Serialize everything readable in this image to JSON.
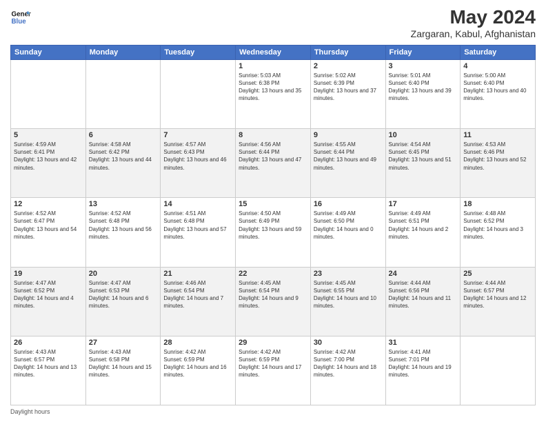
{
  "header": {
    "logo_line1": "General",
    "logo_line2": "Blue",
    "title": "May 2024",
    "subtitle": "Zargaran, Kabul, Afghanistan"
  },
  "days_of_week": [
    "Sunday",
    "Monday",
    "Tuesday",
    "Wednesday",
    "Thursday",
    "Friday",
    "Saturday"
  ],
  "weeks": [
    [
      {
        "day": "",
        "sunrise": "",
        "sunset": "",
        "daylight": ""
      },
      {
        "day": "",
        "sunrise": "",
        "sunset": "",
        "daylight": ""
      },
      {
        "day": "",
        "sunrise": "",
        "sunset": "",
        "daylight": ""
      },
      {
        "day": "1",
        "sunrise": "Sunrise: 5:03 AM",
        "sunset": "Sunset: 6:38 PM",
        "daylight": "Daylight: 13 hours and 35 minutes."
      },
      {
        "day": "2",
        "sunrise": "Sunrise: 5:02 AM",
        "sunset": "Sunset: 6:39 PM",
        "daylight": "Daylight: 13 hours and 37 minutes."
      },
      {
        "day": "3",
        "sunrise": "Sunrise: 5:01 AM",
        "sunset": "Sunset: 6:40 PM",
        "daylight": "Daylight: 13 hours and 39 minutes."
      },
      {
        "day": "4",
        "sunrise": "Sunrise: 5:00 AM",
        "sunset": "Sunset: 6:40 PM",
        "daylight": "Daylight: 13 hours and 40 minutes."
      }
    ],
    [
      {
        "day": "5",
        "sunrise": "Sunrise: 4:59 AM",
        "sunset": "Sunset: 6:41 PM",
        "daylight": "Daylight: 13 hours and 42 minutes."
      },
      {
        "day": "6",
        "sunrise": "Sunrise: 4:58 AM",
        "sunset": "Sunset: 6:42 PM",
        "daylight": "Daylight: 13 hours and 44 minutes."
      },
      {
        "day": "7",
        "sunrise": "Sunrise: 4:57 AM",
        "sunset": "Sunset: 6:43 PM",
        "daylight": "Daylight: 13 hours and 46 minutes."
      },
      {
        "day": "8",
        "sunrise": "Sunrise: 4:56 AM",
        "sunset": "Sunset: 6:44 PM",
        "daylight": "Daylight: 13 hours and 47 minutes."
      },
      {
        "day": "9",
        "sunrise": "Sunrise: 4:55 AM",
        "sunset": "Sunset: 6:44 PM",
        "daylight": "Daylight: 13 hours and 49 minutes."
      },
      {
        "day": "10",
        "sunrise": "Sunrise: 4:54 AM",
        "sunset": "Sunset: 6:45 PM",
        "daylight": "Daylight: 13 hours and 51 minutes."
      },
      {
        "day": "11",
        "sunrise": "Sunrise: 4:53 AM",
        "sunset": "Sunset: 6:46 PM",
        "daylight": "Daylight: 13 hours and 52 minutes."
      }
    ],
    [
      {
        "day": "12",
        "sunrise": "Sunrise: 4:52 AM",
        "sunset": "Sunset: 6:47 PM",
        "daylight": "Daylight: 13 hours and 54 minutes."
      },
      {
        "day": "13",
        "sunrise": "Sunrise: 4:52 AM",
        "sunset": "Sunset: 6:48 PM",
        "daylight": "Daylight: 13 hours and 56 minutes."
      },
      {
        "day": "14",
        "sunrise": "Sunrise: 4:51 AM",
        "sunset": "Sunset: 6:48 PM",
        "daylight": "Daylight: 13 hours and 57 minutes."
      },
      {
        "day": "15",
        "sunrise": "Sunrise: 4:50 AM",
        "sunset": "Sunset: 6:49 PM",
        "daylight": "Daylight: 13 hours and 59 minutes."
      },
      {
        "day": "16",
        "sunrise": "Sunrise: 4:49 AM",
        "sunset": "Sunset: 6:50 PM",
        "daylight": "Daylight: 14 hours and 0 minutes."
      },
      {
        "day": "17",
        "sunrise": "Sunrise: 4:49 AM",
        "sunset": "Sunset: 6:51 PM",
        "daylight": "Daylight: 14 hours and 2 minutes."
      },
      {
        "day": "18",
        "sunrise": "Sunrise: 4:48 AM",
        "sunset": "Sunset: 6:52 PM",
        "daylight": "Daylight: 14 hours and 3 minutes."
      }
    ],
    [
      {
        "day": "19",
        "sunrise": "Sunrise: 4:47 AM",
        "sunset": "Sunset: 6:52 PM",
        "daylight": "Daylight: 14 hours and 4 minutes."
      },
      {
        "day": "20",
        "sunrise": "Sunrise: 4:47 AM",
        "sunset": "Sunset: 6:53 PM",
        "daylight": "Daylight: 14 hours and 6 minutes."
      },
      {
        "day": "21",
        "sunrise": "Sunrise: 4:46 AM",
        "sunset": "Sunset: 6:54 PM",
        "daylight": "Daylight: 14 hours and 7 minutes."
      },
      {
        "day": "22",
        "sunrise": "Sunrise: 4:45 AM",
        "sunset": "Sunset: 6:54 PM",
        "daylight": "Daylight: 14 hours and 9 minutes."
      },
      {
        "day": "23",
        "sunrise": "Sunrise: 4:45 AM",
        "sunset": "Sunset: 6:55 PM",
        "daylight": "Daylight: 14 hours and 10 minutes."
      },
      {
        "day": "24",
        "sunrise": "Sunrise: 4:44 AM",
        "sunset": "Sunset: 6:56 PM",
        "daylight": "Daylight: 14 hours and 11 minutes."
      },
      {
        "day": "25",
        "sunrise": "Sunrise: 4:44 AM",
        "sunset": "Sunset: 6:57 PM",
        "daylight": "Daylight: 14 hours and 12 minutes."
      }
    ],
    [
      {
        "day": "26",
        "sunrise": "Sunrise: 4:43 AM",
        "sunset": "Sunset: 6:57 PM",
        "daylight": "Daylight: 14 hours and 13 minutes."
      },
      {
        "day": "27",
        "sunrise": "Sunrise: 4:43 AM",
        "sunset": "Sunset: 6:58 PM",
        "daylight": "Daylight: 14 hours and 15 minutes."
      },
      {
        "day": "28",
        "sunrise": "Sunrise: 4:42 AM",
        "sunset": "Sunset: 6:59 PM",
        "daylight": "Daylight: 14 hours and 16 minutes."
      },
      {
        "day": "29",
        "sunrise": "Sunrise: 4:42 AM",
        "sunset": "Sunset: 6:59 PM",
        "daylight": "Daylight: 14 hours and 17 minutes."
      },
      {
        "day": "30",
        "sunrise": "Sunrise: 4:42 AM",
        "sunset": "Sunset: 7:00 PM",
        "daylight": "Daylight: 14 hours and 18 minutes."
      },
      {
        "day": "31",
        "sunrise": "Sunrise: 4:41 AM",
        "sunset": "Sunset: 7:01 PM",
        "daylight": "Daylight: 14 hours and 19 minutes."
      },
      {
        "day": "",
        "sunrise": "",
        "sunset": "",
        "daylight": ""
      }
    ]
  ],
  "footer": {
    "daylight_hours_label": "Daylight hours"
  }
}
